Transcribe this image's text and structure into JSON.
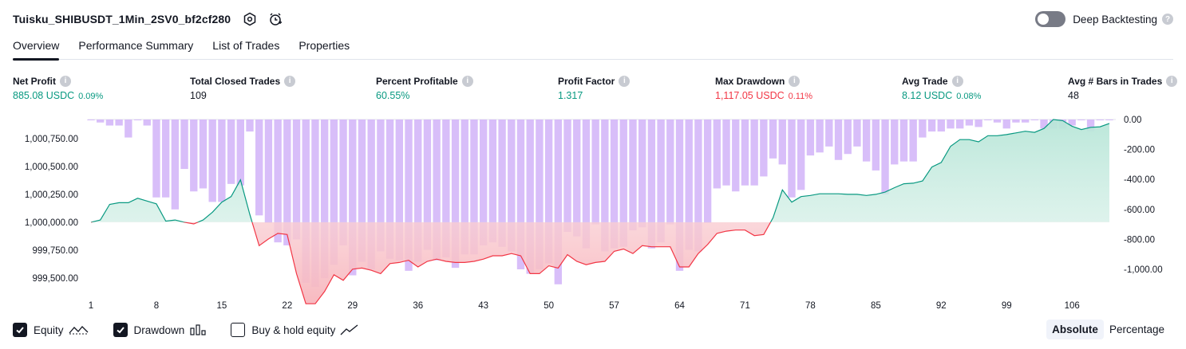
{
  "header": {
    "title": "Tuisku_SHIBUSDT_1Min_2SV0_bf2cf280",
    "deep_backtesting_label": "Deep Backtesting"
  },
  "tabs": [
    "Overview",
    "Performance Summary",
    "List of Trades",
    "Properties"
  ],
  "metrics": [
    {
      "label": "Net Profit",
      "value": "885.08 USDC",
      "pct": "0.09%",
      "tone": "pos"
    },
    {
      "label": "Total Closed Trades",
      "value": "109",
      "pct": "",
      "tone": "neu"
    },
    {
      "label": "Percent Profitable",
      "value": "60.55%",
      "pct": "",
      "tone": "pos"
    },
    {
      "label": "Profit Factor",
      "value": "1.317",
      "pct": "",
      "tone": "pos"
    },
    {
      "label": "Max Drawdown",
      "value": "1,117.05 USDC",
      "pct": "0.11%",
      "tone": "neg"
    },
    {
      "label": "Avg Trade",
      "value": "8.12 USDC",
      "pct": "0.08%",
      "tone": "pos"
    },
    {
      "label": "Avg # Bars in Trades",
      "value": "48",
      "pct": "",
      "tone": "neu"
    }
  ],
  "legend": {
    "equity": "Equity",
    "drawdown": "Drawdown",
    "buy_hold": "Buy & hold equity",
    "equity_checked": true,
    "drawdown_checked": true,
    "buy_hold_checked": false
  },
  "mode": {
    "absolute": "Absolute",
    "percentage": "Percentage",
    "selected": "Absolute"
  },
  "colors": {
    "profit": "#089981",
    "loss": "#f23645",
    "drawdown_bar": "#d1b3f8",
    "equity_fill": "#d4f0e8",
    "loss_fill": "#fbd5d8"
  },
  "chart_data": {
    "type": "area",
    "x_tick_labels": [
      "1",
      "8",
      "15",
      "22",
      "29",
      "36",
      "43",
      "50",
      "57",
      "64",
      "71",
      "78",
      "85",
      "92",
      "99",
      "106"
    ],
    "left_tick_labels": [
      "1,000,750.00",
      "1,000,500.00",
      "1,000,250.00",
      "1,000,000.00",
      "999,750.00",
      "999,500.00"
    ],
    "right_tick_labels": [
      "0.00",
      "-200.00",
      "-400.00",
      "-600.00",
      "-800.00",
      "-1,000.00"
    ],
    "left_ylim": [
      999350,
      1000920
    ],
    "right_ylim": [
      -1117,
      0
    ],
    "baseline": 1000000,
    "x_range": [
      1,
      110
    ],
    "series": [
      {
        "kind": "equity",
        "x": [
          1,
          2,
          3,
          4,
          5,
          6,
          7,
          8,
          9,
          10,
          11,
          12,
          13,
          14,
          15,
          16,
          17,
          18,
          19,
          20,
          21,
          22,
          23,
          24,
          25,
          26,
          27,
          28,
          29,
          30,
          31,
          32,
          33,
          34,
          35,
          36,
          37,
          38,
          39,
          40,
          41,
          42,
          43,
          44,
          45,
          46,
          47,
          48,
          49,
          50,
          51,
          52,
          53,
          54,
          55,
          56,
          57,
          58,
          59,
          60,
          61,
          62,
          63,
          64,
          65,
          66,
          67,
          68,
          69,
          70,
          71,
          72,
          73,
          74,
          75,
          76,
          77,
          78,
          79,
          80,
          81,
          82,
          83,
          84,
          85,
          86,
          87,
          88,
          89,
          90,
          91,
          92,
          93,
          94,
          95,
          96,
          97,
          98,
          99,
          100,
          101,
          102,
          103,
          104,
          105,
          106,
          107,
          108,
          109,
          110
        ],
        "values": [
          1000000,
          1000020,
          1000160,
          1000175,
          1000175,
          1000215,
          1000190,
          1000165,
          1000010,
          1000020,
          1000000,
          999985,
          1000020,
          1000090,
          1000180,
          1000230,
          1000380,
          1000070,
          999790,
          999850,
          999900,
          999890,
          999540,
          999270,
          999270,
          999380,
          999530,
          999480,
          999580,
          999590,
          999570,
          999540,
          999630,
          999640,
          999660,
          999600,
          999650,
          999670,
          999650,
          999640,
          999640,
          999650,
          999670,
          999700,
          999700,
          999720,
          999700,
          999540,
          999540,
          999610,
          999590,
          999710,
          999650,
          999620,
          999640,
          999650,
          999740,
          999760,
          999720,
          999790,
          999780,
          999780,
          999780,
          999600,
          999600,
          999720,
          999800,
          999900,
          999920,
          999930,
          999930,
          999880,
          999890,
          1000040,
          1000290,
          1000180,
          1000230,
          1000240,
          1000255,
          1000255,
          1000255,
          1000250,
          1000250,
          1000240,
          1000250,
          1000270,
          1000310,
          1000345,
          1000350,
          1000370,
          1000495,
          1000535,
          1000680,
          1000740,
          1000740,
          1000720,
          1000775,
          1000775,
          1000785,
          1000800,
          1000815,
          1000805,
          1000840,
          1000920,
          1000910,
          1000860,
          1000830,
          1000850,
          1000855,
          1000885
        ]
      },
      {
        "kind": "drawdown",
        "x": [
          1,
          2,
          3,
          4,
          5,
          6,
          7,
          8,
          9,
          10,
          11,
          12,
          13,
          14,
          15,
          16,
          17,
          18,
          19,
          20,
          21,
          22,
          23,
          24,
          25,
          26,
          27,
          28,
          29,
          30,
          31,
          32,
          33,
          34,
          35,
          36,
          37,
          38,
          39,
          40,
          41,
          42,
          43,
          44,
          45,
          46,
          47,
          48,
          49,
          50,
          51,
          52,
          53,
          54,
          55,
          56,
          57,
          58,
          59,
          60,
          61,
          62,
          63,
          64,
          65,
          66,
          67,
          68,
          69,
          70,
          71,
          72,
          73,
          74,
          75,
          76,
          77,
          78,
          79,
          80,
          81,
          82,
          83,
          84,
          85,
          86,
          87,
          88,
          89,
          90,
          91,
          92,
          93,
          94,
          95,
          96,
          97,
          98,
          99,
          100,
          101,
          102,
          103,
          104,
          105,
          106,
          107,
          108,
          109,
          110
        ],
        "values": [
          0,
          -20,
          -40,
          -40,
          -120,
          0,
          -40,
          -520,
          -520,
          -600,
          -330,
          -480,
          -460,
          -550,
          -550,
          -430,
          -440,
          -80,
          -640,
          -690,
          -820,
          -840,
          -800,
          -1090,
          -1117,
          -1060,
          -970,
          -840,
          -1040,
          -950,
          -1000,
          -880,
          -930,
          -940,
          -1010,
          -950,
          -870,
          -940,
          -920,
          -990,
          -900,
          -900,
          -840,
          -820,
          -850,
          -880,
          -1000,
          -1030,
          -1000,
          -960,
          -1100,
          -750,
          -780,
          -860,
          -700,
          -880,
          -860,
          -850,
          -740,
          -720,
          -860,
          -820,
          -700,
          -1010,
          -870,
          -880,
          -690,
          -460,
          -440,
          -480,
          -440,
          -440,
          -380,
          -260,
          -300,
          -520,
          -470,
          -240,
          -220,
          -180,
          -270,
          -230,
          -180,
          -280,
          -340,
          -500,
          -300,
          -280,
          -280,
          -120,
          -80,
          -80,
          -60,
          -60,
          -40,
          -50,
          0,
          -20,
          -60,
          -20,
          -20,
          0,
          -60,
          -60,
          -60,
          -40,
          0,
          -80,
          0,
          0
        ]
      }
    ]
  }
}
